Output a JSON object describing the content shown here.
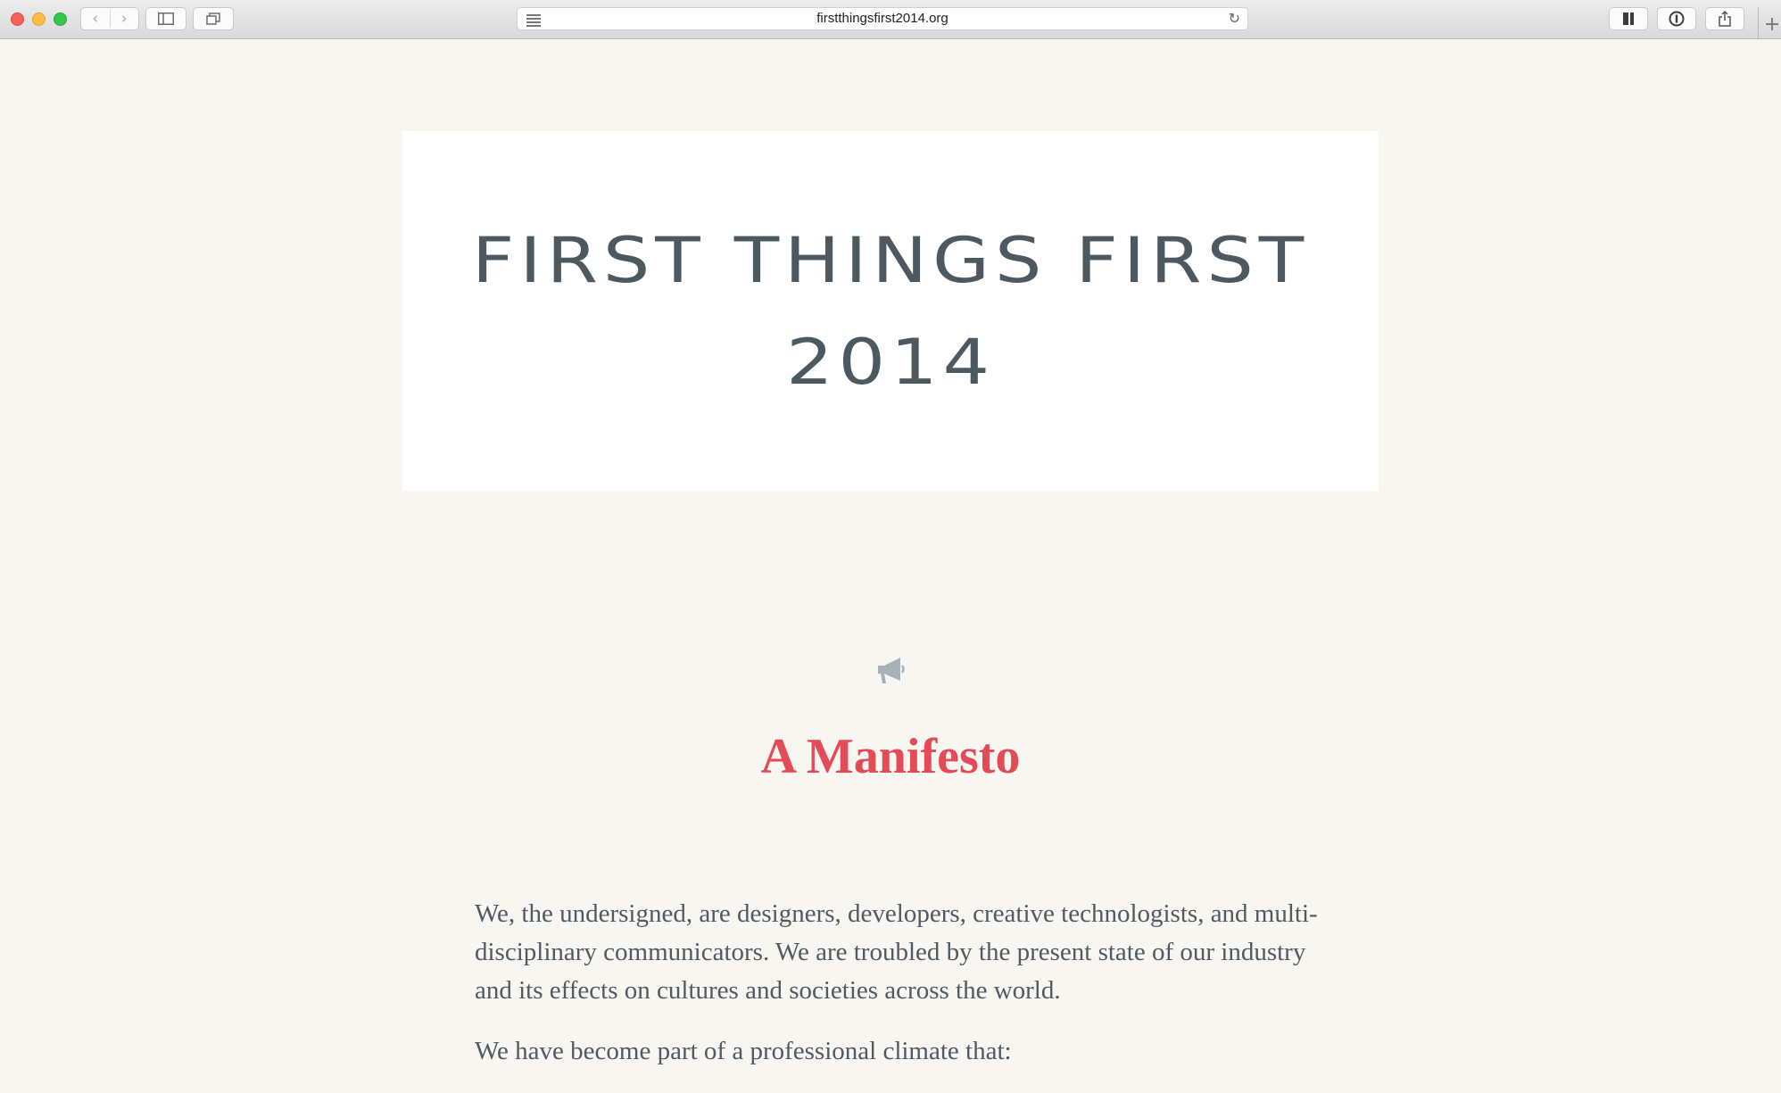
{
  "browser": {
    "url": "firstthingsfirst2014.org",
    "back_glyph": "‹",
    "forward_glyph": "›",
    "reload_glyph": "↻",
    "newtab_glyph": "+"
  },
  "hero": {
    "title": "FIRST THINGS FIRST 2014"
  },
  "section": {
    "icon": "megaphone-icon",
    "heading": "A Manifesto"
  },
  "body": {
    "paragraphs": [
      "We, the undersigned, are designers, developers, creative technologists, and multi-disciplinary communicators. We are troubled by the present state of our industry and its effects on cultures and societies across the world.",
      "We have become part of a professional climate that:"
    ]
  },
  "colors": {
    "page_bg": "#f7f6f0",
    "hero_bg": "#ffffff",
    "title_color": "#4c5961",
    "accent": "#e24b57",
    "text": "#4f5a62"
  }
}
